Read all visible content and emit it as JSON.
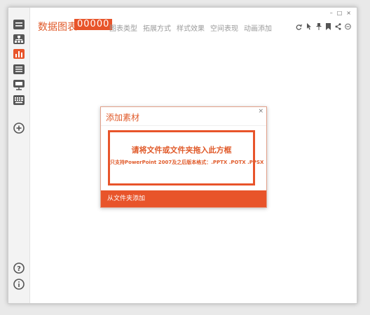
{
  "app": {
    "title": "数据图表",
    "counter": "00000"
  },
  "menu": [
    {
      "label": "图表类型"
    },
    {
      "label": "拓展方式"
    },
    {
      "label": "样式效果"
    },
    {
      "label": "空间表现"
    },
    {
      "label": "动画添加"
    }
  ],
  "window_controls": {
    "minimize": "–",
    "maximize": "□",
    "close": "×"
  },
  "sidebar": {
    "items": [
      {
        "icon": "text-card-icon"
      },
      {
        "icon": "org-chart-icon"
      },
      {
        "icon": "bar-chart-icon",
        "active": true
      },
      {
        "icon": "list-table-icon"
      },
      {
        "icon": "presentation-icon"
      },
      {
        "icon": "keyboard-icon"
      },
      {
        "icon": "add-circle-icon"
      }
    ],
    "bottom": [
      {
        "icon": "help-icon"
      },
      {
        "icon": "info-icon"
      }
    ]
  },
  "toolbar_icons": [
    "refresh-icon",
    "pointer-icon",
    "pin-icon",
    "bookmark-icon",
    "share-icon",
    "minus-circle-icon"
  ],
  "dialog": {
    "title": "添加素材",
    "close": "×",
    "drop_text": "请将文件或文件夹拖入此方框",
    "drop_hint": "只支持PowerPoint 2007及之后版本格式：.PPTX .POTX .PPSX",
    "add_button": "从文件夹添加"
  },
  "colors": {
    "accent": "#e8542a",
    "sidebar_icon": "#555555",
    "menu_text": "#9a9a9a"
  }
}
